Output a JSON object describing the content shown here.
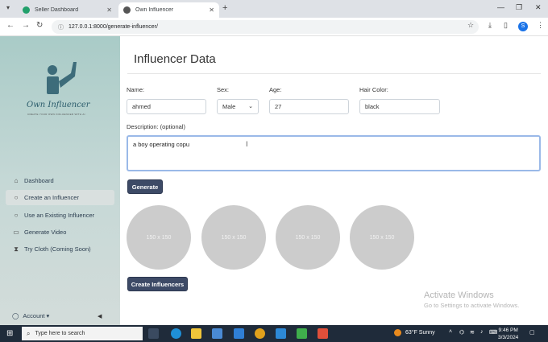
{
  "browser": {
    "tabs": [
      {
        "title": "Seller Dashboard",
        "active": false,
        "favicon_color": "#22a06b"
      },
      {
        "title": "Own Influencer",
        "active": true,
        "favicon_color": "#555555"
      }
    ],
    "url": "127.0.0.1:8000/generate-influencer/",
    "profile_initial": "S"
  },
  "sidebar": {
    "logo_text": "Own Influencer",
    "logo_tagline": "CREATE YOUR OWN INFLUENCER WITH AI",
    "items": [
      {
        "label": "Dashboard",
        "icon": "home-icon",
        "active": false
      },
      {
        "label": "Create an Influencer",
        "icon": "chat-icon",
        "active": true
      },
      {
        "label": "Use an Existing Influencer",
        "icon": "chat-icon",
        "active": false
      },
      {
        "label": "Generate Video",
        "icon": "video-icon",
        "active": false
      },
      {
        "label": "Try Cloth (Coming Soon)",
        "icon": "hourglass-icon",
        "active": false
      }
    ],
    "account_label": "Account"
  },
  "form": {
    "heading": "Influencer Data",
    "name_label": "Name:",
    "name_value": "ahmed",
    "sex_label": "Sex:",
    "sex_value": "Male",
    "age_label": "Age:",
    "age_value": "27",
    "hair_label": "Hair Color:",
    "hair_value": "black",
    "description_label": "Description: (optional)",
    "description_value": "a boy operating copu",
    "generate_label": "Generate",
    "placeholders": [
      "150 x 150",
      "150 x 150",
      "150 x 150",
      "150 x 150"
    ],
    "create_label": "Create Influencers"
  },
  "watermark": {
    "line1": "Activate Windows",
    "line2": "Go to Settings to activate Windows."
  },
  "taskbar": {
    "search_placeholder": "Type here to search",
    "weather": "63°F  Sunny",
    "time": "9:46 PM",
    "date": "3/3/2024"
  },
  "colors": {
    "sidebar_top": "#a9cbc7",
    "button": "#3d4a66",
    "placeholder_circle": "#cccccc",
    "taskbar": "#1f2b3a"
  }
}
